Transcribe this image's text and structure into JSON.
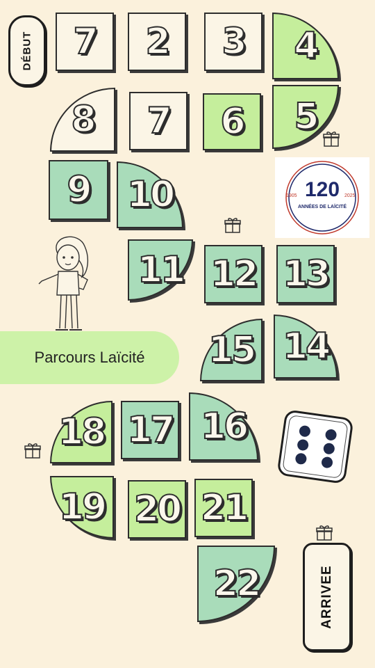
{
  "board": {
    "start_label": "DÉBUT",
    "finish_label": "ARRIVEE",
    "title": "Parcours Laïcité",
    "squares": [
      {
        "label": "7",
        "style": "blank"
      },
      {
        "label": "2",
        "style": "blank"
      },
      {
        "label": "3",
        "style": "blank"
      },
      {
        "label": "4",
        "style": "light-green"
      },
      {
        "label": "5",
        "style": "light-green"
      },
      {
        "label": "6",
        "style": "light-green"
      },
      {
        "label": "7",
        "style": "blank"
      },
      {
        "label": "8",
        "style": "blank"
      },
      {
        "label": "9",
        "style": "mint-green"
      },
      {
        "label": "10",
        "style": "mint-green"
      },
      {
        "label": "11",
        "style": "mint-green"
      },
      {
        "label": "12",
        "style": "mint-green"
      },
      {
        "label": "13",
        "style": "mint-green"
      },
      {
        "label": "14",
        "style": "mint-green"
      },
      {
        "label": "15",
        "style": "mint-green"
      },
      {
        "label": "16",
        "style": "mint-green"
      },
      {
        "label": "17",
        "style": "mint-green"
      },
      {
        "label": "18",
        "style": "light-green"
      },
      {
        "label": "19",
        "style": "light-green"
      },
      {
        "label": "20",
        "style": "light-green"
      },
      {
        "label": "21",
        "style": "light-green"
      },
      {
        "label": "22",
        "style": "mint-green"
      }
    ]
  },
  "logo": {
    "number": "120",
    "year_start": "1905",
    "year_end": "2025",
    "caption": "ANNÉES DE LAÏCITÉ"
  },
  "dice": {
    "value": 6
  },
  "icons": {
    "gift": "gift-icon",
    "dice": "dice-icon",
    "character": "girl-character"
  },
  "colors": {
    "background": "#fbf1dc",
    "light_green": "#c5ee9c",
    "mint_green": "#a9dcba",
    "logo_blue": "#1f2a6b",
    "logo_red": "#c0392b"
  }
}
